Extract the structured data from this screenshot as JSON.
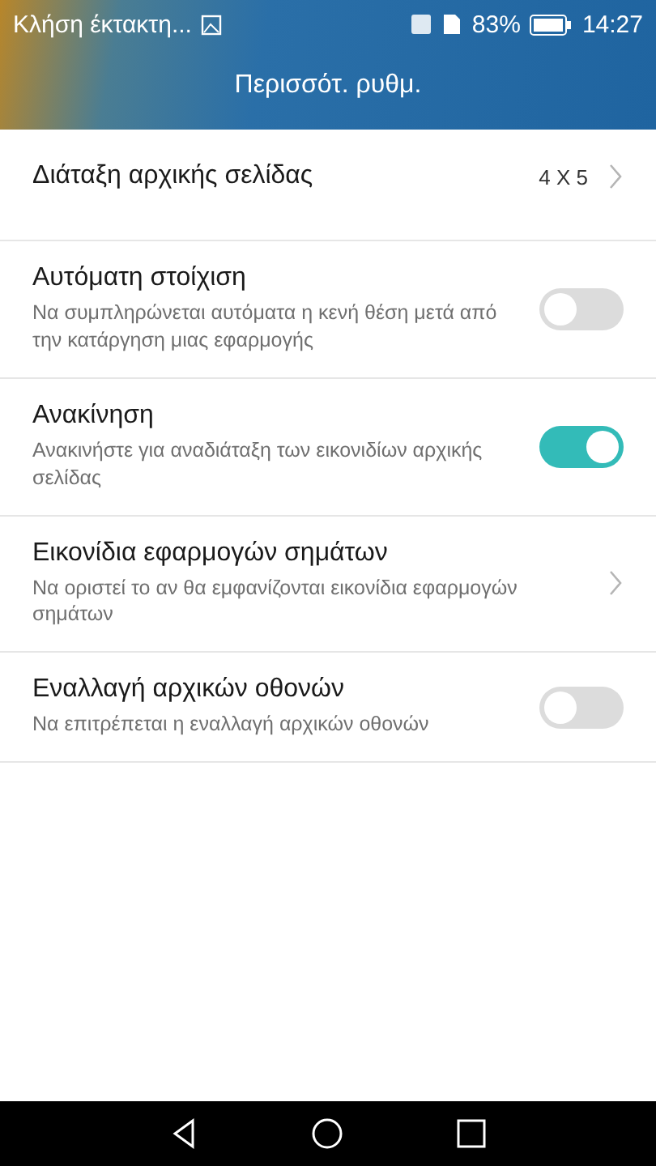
{
  "status_bar": {
    "notification": "Κλήση έκτακτη...",
    "battery": "83%",
    "time": "14:27"
  },
  "header": {
    "title": "Περισσότ. ρυθμ."
  },
  "settings": [
    {
      "kind": "value",
      "title": "Διάταξη αρχικής σελίδας",
      "value": "4 X 5"
    },
    {
      "kind": "toggle",
      "title": "Αυτόματη στοίχιση",
      "subtitle": "Να συμπληρώνεται αυτόματα η κενή θέση μετά από την κατάργηση μιας εφαρμογής",
      "on": false
    },
    {
      "kind": "toggle",
      "title": "Ανακίνηση",
      "subtitle": "Ανακινήστε για αναδιάταξη των εικονιδίων αρχικής σελίδας",
      "on": true
    },
    {
      "kind": "link",
      "title": "Εικονίδια εφαρμογών σημάτων",
      "subtitle": "Να οριστεί το αν θα εμφανίζονται εικονίδια εφαρμογών σημάτων"
    },
    {
      "kind": "toggle",
      "title": "Εναλλαγή αρχικών οθονών",
      "subtitle": "Να επιτρέπεται η εναλλαγή αρχικών οθονών",
      "on": false
    }
  ]
}
